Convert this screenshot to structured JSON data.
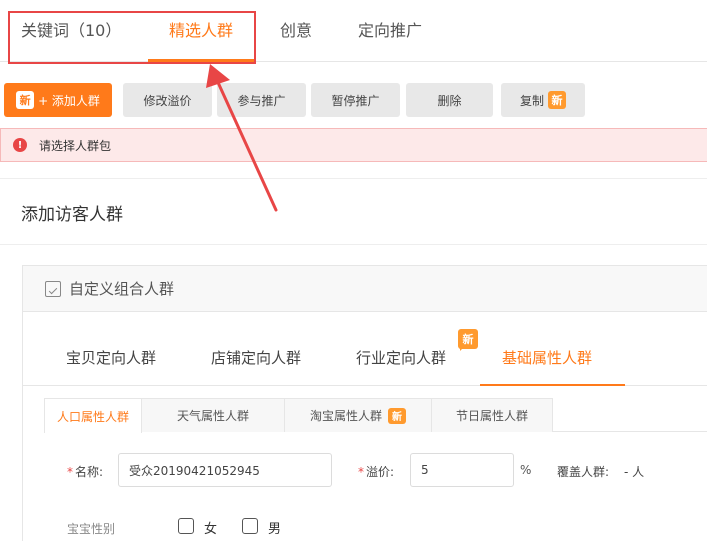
{
  "top_tabs": [
    {
      "label": "关键词（10）",
      "active": false
    },
    {
      "label": "精选人群",
      "active": true
    },
    {
      "label": "创意",
      "active": false
    },
    {
      "label": "定向推广",
      "active": false
    }
  ],
  "toolbar": {
    "new_badge": "新",
    "add_crowd": "+ 添加人群",
    "edit_premium": "修改溢价",
    "join_promo": "参与推广",
    "pause_promo": "暂停推广",
    "delete": "删除",
    "copy": "复制",
    "copy_badge": "新"
  },
  "alert": {
    "icon": "!",
    "text": "请选择人群包"
  },
  "section_title": "添加访客人群",
  "card": {
    "title": "自定义组合人群"
  },
  "l2_tabs": [
    {
      "label": "宝贝定向人群",
      "active": false
    },
    {
      "label": "店铺定向人群",
      "active": false
    },
    {
      "label": "行业定向人群",
      "active": false,
      "badge": "新"
    },
    {
      "label": "基础属性人群",
      "active": true
    }
  ],
  "l3_tabs": [
    {
      "label": "人口属性人群",
      "active": true
    },
    {
      "label": "天气属性人群",
      "active": false
    },
    {
      "label": "淘宝属性人群",
      "active": false,
      "badge": "新"
    },
    {
      "label": "节日属性人群",
      "active": false
    }
  ],
  "form": {
    "required_mark": "*",
    "name_label": "名称:",
    "name_value": "受众20190421052945",
    "premium_label": "溢价:",
    "premium_value": "5",
    "premium_unit": "%",
    "coverage_label": "覆盖人群:",
    "coverage_value": "- 人"
  },
  "gender": {
    "label": "宝宝性别",
    "options": [
      "女",
      "男"
    ]
  },
  "colors": {
    "accent": "#ff7a1a",
    "alert_red": "#e84646",
    "badge": "#ff9a2e"
  }
}
